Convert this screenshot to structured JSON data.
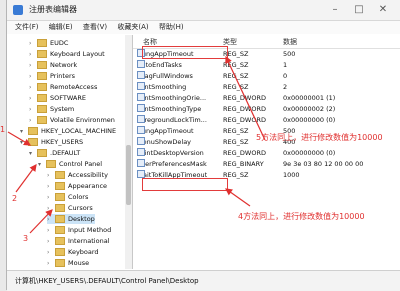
{
  "window": {
    "title": "注册表编辑器",
    "minimize": "–",
    "maximize": "□",
    "close": "✕"
  },
  "menu": [
    "文件(F)",
    "编辑(E)",
    "查看(V)",
    "收藏夹(A)",
    "帮助(H)"
  ],
  "tree": [
    {
      "label": "EUDC",
      "indent": 2
    },
    {
      "label": "Keyboard Layout",
      "indent": 2
    },
    {
      "label": "Network",
      "indent": 2
    },
    {
      "label": "Printers",
      "indent": 2
    },
    {
      "label": "RemoteAccess",
      "indent": 2
    },
    {
      "label": "SOFTWARE",
      "indent": 2
    },
    {
      "label": "System",
      "indent": 2
    },
    {
      "label": "Volatile Environmen",
      "indent": 2
    },
    {
      "label": "HKEY_LOCAL_MACHINE",
      "indent": 1
    },
    {
      "label": "HKEY_USERS",
      "indent": 1
    },
    {
      "label": ".DEFAULT",
      "indent": 2
    },
    {
      "label": "Control Panel",
      "indent": 3
    },
    {
      "label": "Accessibility",
      "indent": 4
    },
    {
      "label": "Appearance",
      "indent": 4
    },
    {
      "label": "Colors",
      "indent": 4
    },
    {
      "label": "Cursors",
      "indent": 4
    },
    {
      "label": "Desktop",
      "indent": 4
    },
    {
      "label": "Input Method",
      "indent": 4
    },
    {
      "label": "International",
      "indent": 4
    },
    {
      "label": "Keyboard",
      "indent": 4
    },
    {
      "label": "Mouse",
      "indent": 4
    }
  ],
  "columns": {
    "name": "名称",
    "type": "类型",
    "data": "数据"
  },
  "values": [
    {
      "name": "HungAppTimeout",
      "type": "REG_SZ",
      "data": "500"
    },
    {
      "name": "AutoEndTasks",
      "type": "REG_SZ",
      "data": "1"
    },
    {
      "name": "DragFullWindows",
      "type": "REG_SZ",
      "data": "0"
    },
    {
      "name": "FontSmoothing",
      "type": "REG_SZ",
      "data": "2"
    },
    {
      "name": "FontSmoothingOrie...",
      "type": "REG_DWORD",
      "data": "0x00000001 (1)"
    },
    {
      "name": "FontSmoothingType",
      "type": "REG_DWORD",
      "data": "0x00000002 (2)"
    },
    {
      "name": "ForegroundLockTim...",
      "type": "REG_DWORD",
      "data": "0x00000000 (0)"
    },
    {
      "name": "HungAppTimeout",
      "type": "REG_SZ",
      "data": "500"
    },
    {
      "name": "MenuShowDelay",
      "type": "REG_SZ",
      "data": "400"
    },
    {
      "name": "PaintDesktopVersion",
      "type": "REG_DWORD",
      "data": "0x00000000 (0)"
    },
    {
      "name": "UserPreferencesMask",
      "type": "REG_BINARY",
      "data": "9e 3e 03 80 12 00 00 00"
    },
    {
      "name": "WaitToKillAppTimeout",
      "type": "REG_SZ",
      "data": "1000"
    }
  ],
  "annotations": {
    "a1": "1",
    "a2": "2",
    "a3": "3",
    "a4": "4方法同上，进行修改数值为10000",
    "a5": "5方法同上，进行修改数值为10000"
  },
  "status": "计算机\\HKEY_USERS\\.DEFAULT\\Control Panel\\Desktop",
  "colors": {
    "annotation": "#e0302f",
    "selection": "#cce4f7"
  }
}
